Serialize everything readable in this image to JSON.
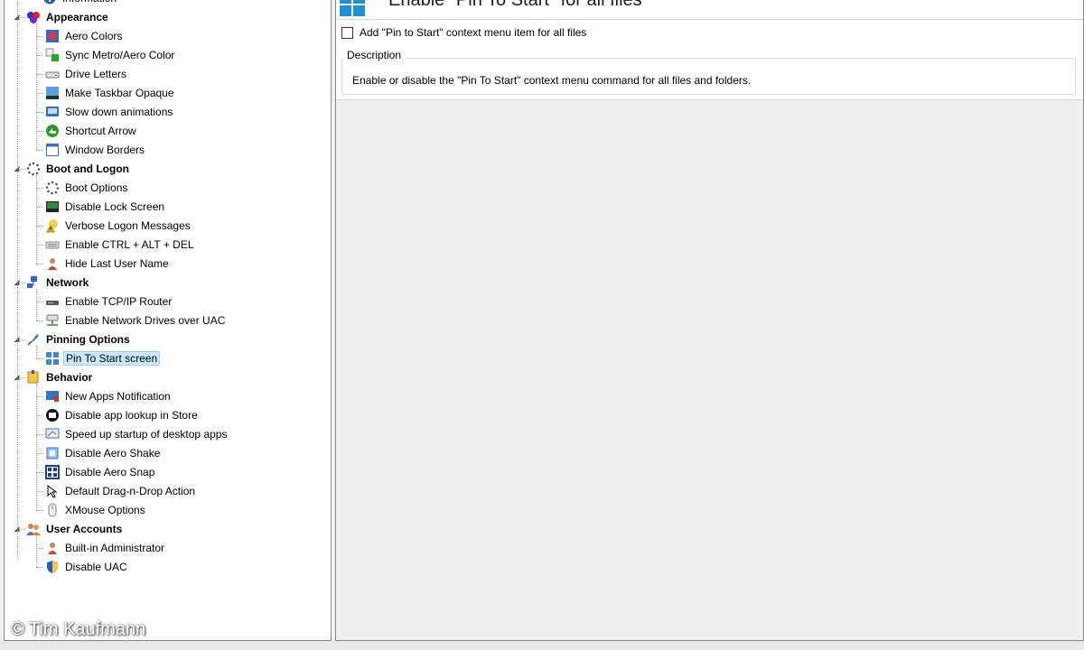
{
  "tree": {
    "partial_top_item": "Information",
    "categories": [
      {
        "label": "Appearance",
        "icon": "appearance-icon",
        "items": [
          {
            "label": "Aero Colors",
            "icon": "aero-colors-icon"
          },
          {
            "label": "Sync Metro/Aero Color",
            "icon": "sync-color-icon"
          },
          {
            "label": "Drive Letters",
            "icon": "drive-icon"
          },
          {
            "label": "Make Taskbar Opaque",
            "icon": "taskbar-icon"
          },
          {
            "label": "Slow down animations",
            "icon": "animation-icon"
          },
          {
            "label": "Shortcut Arrow",
            "icon": "shortcut-arrow-icon"
          },
          {
            "label": "Window Borders",
            "icon": "window-borders-icon"
          }
        ]
      },
      {
        "label": "Boot and Logon",
        "icon": "boot-icon",
        "items": [
          {
            "label": "Boot Options",
            "icon": "boot-options-icon"
          },
          {
            "label": "Disable Lock Screen",
            "icon": "lock-screen-icon"
          },
          {
            "label": "Verbose Logon Messages",
            "icon": "verbose-logon-icon"
          },
          {
            "label": "Enable CTRL + ALT + DEL",
            "icon": "keyboard-icon"
          },
          {
            "label": "Hide Last User Name",
            "icon": "user-icon"
          }
        ]
      },
      {
        "label": "Network",
        "icon": "network-icon",
        "items": [
          {
            "label": "Enable TCP/IP Router",
            "icon": "router-icon"
          },
          {
            "label": "Enable Network Drives over UAC",
            "icon": "network-drive-icon"
          }
        ]
      },
      {
        "label": "Pinning Options",
        "icon": "pin-icon",
        "items": [
          {
            "label": "Pin To Start screen",
            "icon": "pin-start-icon",
            "selected": true
          }
        ]
      },
      {
        "label": "Behavior",
        "icon": "behavior-icon",
        "items": [
          {
            "label": "New Apps Notification",
            "icon": "notification-icon"
          },
          {
            "label": "Disable app lookup in Store",
            "icon": "store-icon"
          },
          {
            "label": "Speed up startup of desktop apps",
            "icon": "speed-icon"
          },
          {
            "label": "Disable Aero Shake",
            "icon": "aero-shake-icon"
          },
          {
            "label": "Disable Aero Snap",
            "icon": "aero-snap-icon"
          },
          {
            "label": "Default Drag-n-Drop Action",
            "icon": "drag-drop-icon"
          },
          {
            "label": "XMouse Options",
            "icon": "mouse-icon"
          }
        ]
      },
      {
        "label": "User Accounts",
        "icon": "user-accounts-icon",
        "items": [
          {
            "label": "Built-in Administrator",
            "icon": "admin-icon"
          },
          {
            "label": "Disable UAC",
            "icon": "uac-shield-icon"
          }
        ]
      }
    ]
  },
  "content": {
    "title": "Enable \"Pin To Start\" for all files",
    "checkbox_label": "Add \"Pin to Start\" context menu item for all files",
    "checkbox_checked": false,
    "description_legend": "Description",
    "description_text": "Enable or disable the \"Pin To Start\" context menu command for all files and folders."
  },
  "watermark": "© Tim Kaufmann",
  "colors": {
    "selection_bg": "#cce8ff",
    "selection_border": "#99d1ff",
    "windows_blue": "#1e90d6"
  }
}
